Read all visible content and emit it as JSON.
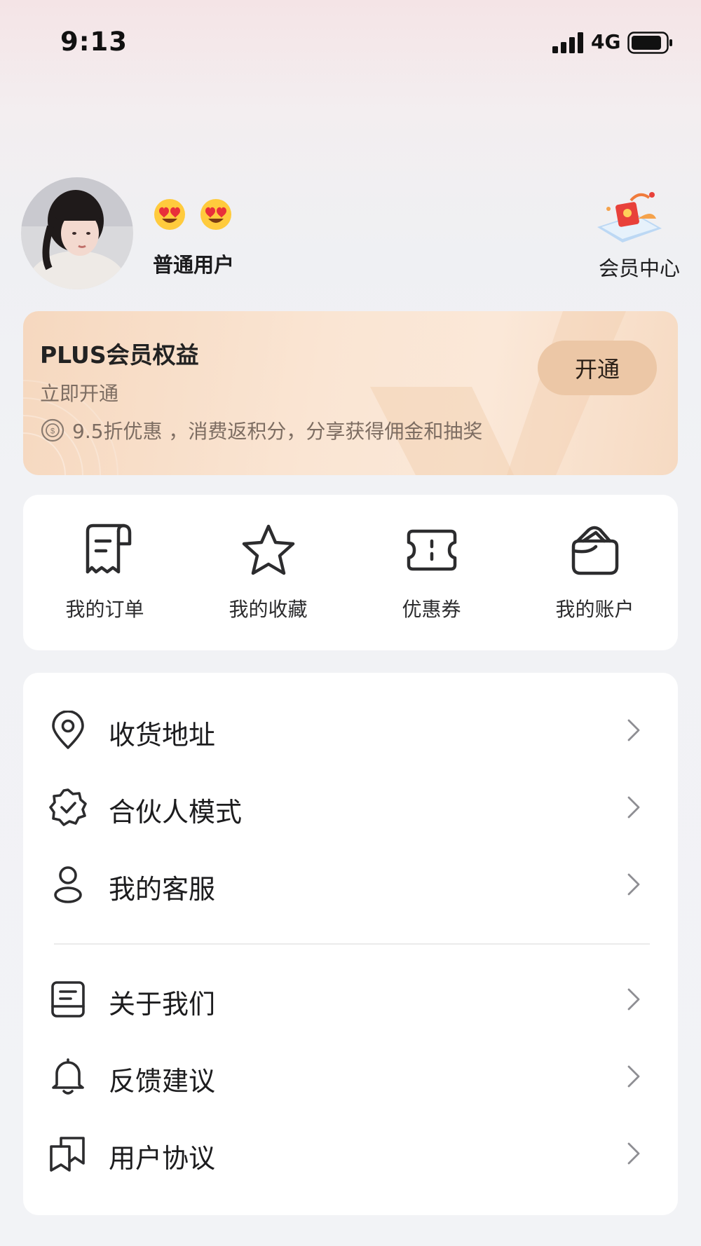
{
  "status_bar": {
    "time": "9:13",
    "network": "4G"
  },
  "profile": {
    "username": "普通用户",
    "emojis": [
      "heart-eyes-emoji",
      "heart-eyes-emoji"
    ],
    "member_center_label": "会员中心"
  },
  "plus_card": {
    "title": "PLUS会员权益",
    "subtitle": "立即开通",
    "benefits": "9.5折优惠 ，消费返积分，分享获得佣金和抽奖",
    "button_label": "开通"
  },
  "quick_actions": [
    {
      "label": "我的订单",
      "icon": "receipt-icon"
    },
    {
      "label": "我的收藏",
      "icon": "star-icon"
    },
    {
      "label": "优惠券",
      "icon": "ticket-icon"
    },
    {
      "label": "我的账户",
      "icon": "wallet-icon"
    }
  ],
  "menu": {
    "group1": [
      {
        "label": "收货地址",
        "icon": "location-pin-icon"
      },
      {
        "label": "合伙人模式",
        "icon": "verified-badge-icon"
      },
      {
        "label": "我的客服",
        "icon": "person-icon"
      }
    ],
    "group2": [
      {
        "label": "关于我们",
        "icon": "document-icon"
      },
      {
        "label": "反馈建议",
        "icon": "bell-icon"
      },
      {
        "label": "用户协议",
        "icon": "book-icon"
      }
    ]
  },
  "colors": {
    "plus_button": "#ecc7a6",
    "plus_card_bg": "#fae5d3",
    "icon_stroke": "#2c2c2e",
    "chevron": "#8e8e93"
  }
}
